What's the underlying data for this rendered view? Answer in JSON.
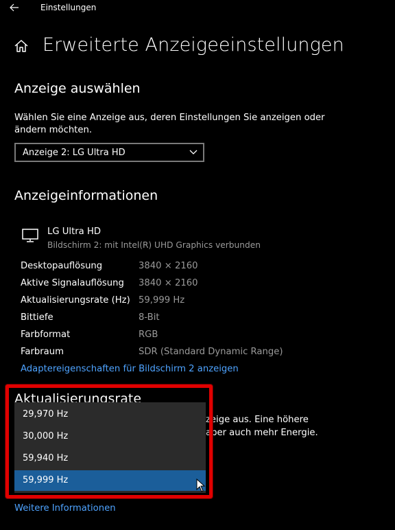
{
  "app": {
    "title": "Einstellungen"
  },
  "page": {
    "title": "Erweiterte Anzeigeeinstellungen"
  },
  "select_display": {
    "heading": "Anzeige auswählen",
    "description_line1": "Wählen Sie eine Anzeige aus, deren Einstellungen Sie anzeigen oder",
    "description_line2": "ändern möchten.",
    "selected": "Anzeige 2: LG Ultra HD"
  },
  "display_info": {
    "heading": "Anzeigeinformationen",
    "monitor_name": "LG Ultra HD",
    "monitor_sub": "Bildschirm 2: mit Intel(R) UHD Graphics verbunden",
    "rows": [
      {
        "label": "Desktopauflösung",
        "value": "3840 × 2160"
      },
      {
        "label": "Aktive Signalauflösung",
        "value": "3840 × 2160"
      },
      {
        "label": "Aktualisierungsrate (Hz)",
        "value": "59,999 Hz"
      },
      {
        "label": "Bittiefe",
        "value": "8-Bit"
      },
      {
        "label": "Farbformat",
        "value": "RGB"
      },
      {
        "label": "Farbraum",
        "value": "SDR (Standard Dynamic Range)"
      }
    ],
    "adapter_link": "Adaptereigenschaften für Bildschirm 2 anzeigen"
  },
  "refresh_rate": {
    "heading": "Aktualisierungsrate",
    "partial_line1": "zeige aus. Eine höhere",
    "partial_line2": "aber auch mehr Energie.",
    "options": [
      "29,970 Hz",
      "30,000 Hz",
      "59,940 Hz",
      "59,999 Hz"
    ],
    "selected_index": 3
  },
  "footer": {
    "more_info_link": "Weitere Informationen"
  },
  "colors": {
    "accent": "#4ea3ff",
    "selected": "#1b5e9a",
    "highlight_frame": "#e00000"
  }
}
